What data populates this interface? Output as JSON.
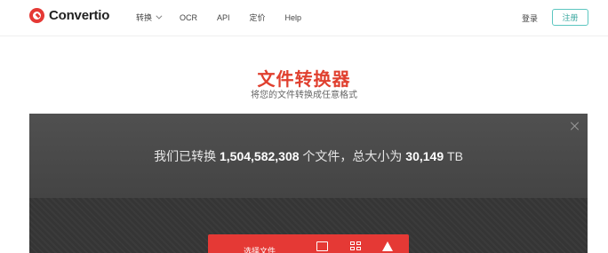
{
  "header": {
    "logo_text": "Convertio",
    "nav": [
      {
        "label": "转换",
        "has_dropdown": true
      },
      {
        "label": "OCR",
        "has_dropdown": false
      },
      {
        "label": "API",
        "has_dropdown": false
      },
      {
        "label": "定价",
        "has_dropdown": false
      },
      {
        "label": "Help",
        "has_dropdown": false
      }
    ],
    "login_label": "登录",
    "register_label": "注册"
  },
  "hero": {
    "title": "文件转换器",
    "subtitle": "将您的文件转换成任意格式"
  },
  "panel": {
    "stats_prefix": "我们已转换",
    "files_count": "1,504,582,308",
    "stats_middle": "个文件，总大小为",
    "total_size": "30,149",
    "size_unit": "TB",
    "choose_files_label": "选择文件"
  },
  "colors": {
    "brand": "#e53935",
    "accent": "#5cc6c0",
    "panel_bg": "#3a3a3a"
  }
}
